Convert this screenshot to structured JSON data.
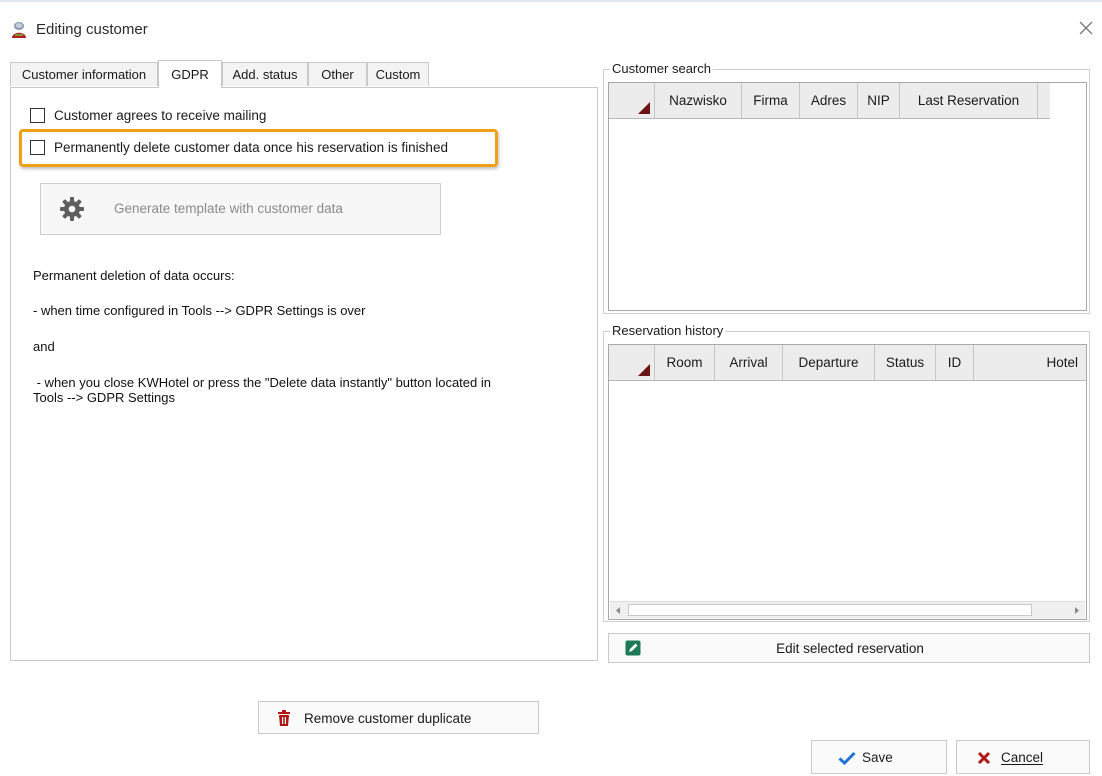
{
  "window": {
    "title": "Editing customer",
    "close_glyph": "×",
    "icons": {
      "app": "customer-app-icon",
      "close": "close-icon"
    }
  },
  "tabs": [
    {
      "label": "Customer information",
      "active": false
    },
    {
      "label": "GDPR",
      "active": true
    },
    {
      "label": "Add. status",
      "active": false
    },
    {
      "label": "Other",
      "active": false
    },
    {
      "label": "Custom",
      "active": false
    }
  ],
  "gdpr": {
    "mailing_label": "Customer agrees to receive mailing",
    "mailing_checked": false,
    "delete_label": "Permanently delete customer data once his reservation is finished",
    "delete_checked": false,
    "highlight_color": "#f0a017",
    "generate_button": "Generate template with customer data",
    "info": {
      "line1": "Permanent deletion of data occurs:",
      "line2": "- when time configured in Tools --> GDPR Settings is over",
      "line3": "and",
      "line4a": " - when you close KWHotel or press the \"Delete data instantly\" button located in",
      "line4b": "Tools --> GDPR Settings"
    }
  },
  "customer_search": {
    "title": "Customer search",
    "columns": [
      "Nazwisko",
      "Firma",
      "Adres",
      "NIP",
      "Last Reservation"
    ],
    "rows": []
  },
  "reservation_history": {
    "title": "Reservation history",
    "columns": [
      "Room",
      "Arrival",
      "Departure",
      "Status",
      "ID",
      "Hotel"
    ],
    "rows": []
  },
  "buttons": {
    "edit_reservation": "Edit selected reservation",
    "remove_duplicate": "Remove customer duplicate",
    "save": "Save",
    "cancel": "Cancel"
  },
  "colors": {
    "accent_red": "#b01818",
    "checkmark_blue": "#1f72d6",
    "edit_icon_green": "#1c7a58",
    "sort_triangle": "#6b1414"
  }
}
